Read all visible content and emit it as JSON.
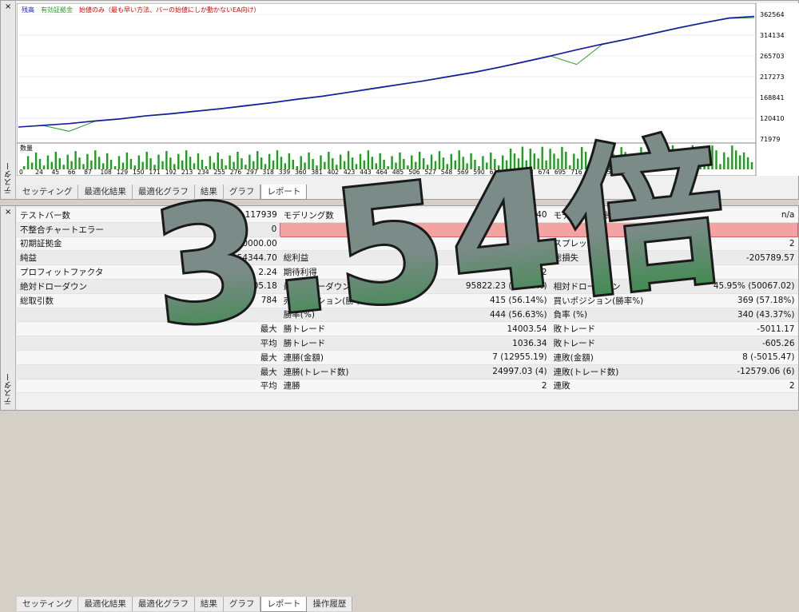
{
  "chart": {
    "legend": [
      "残高",
      "有効証拠金",
      "始値のみ（最も早い方法、バーの始値にしか動かないEA向け）"
    ],
    "legend_colors": [
      "#1a1aa0",
      "#2a9d2a",
      "#e00000"
    ],
    "y_ticks": [
      "362564",
      "314134",
      "265703",
      "217273",
      "168841",
      "120410",
      "71979"
    ],
    "x_ticks": [
      "0",
      "24",
      "45",
      "66",
      "87",
      "108",
      "129",
      "150",
      "171",
      "192",
      "213",
      "234",
      "255",
      "276",
      "297",
      "318",
      "339",
      "360",
      "381",
      "402",
      "423",
      "443",
      "464",
      "485",
      "506",
      "527",
      "548",
      "569",
      "590",
      "611",
      "632",
      "653",
      "674",
      "695",
      "716",
      "737",
      "758",
      "779"
    ],
    "volume_label": "数量"
  },
  "chart_data": {
    "type": "line",
    "title": "",
    "ylim": [
      71979,
      362564
    ],
    "series": [
      {
        "name": "残高",
        "color": "#1a1aa0",
        "values": [
          100000,
          104000,
          108000,
          114000,
          119000,
          126000,
          131000,
          137000,
          143000,
          150000,
          157000,
          165000,
          172000,
          181000,
          190000,
          199000,
          208000,
          218000,
          228000,
          240000,
          253000,
          266000,
          280000,
          293000,
          305000,
          318000,
          331000,
          343000,
          354000,
          358000
        ]
      },
      {
        "name": "有効証拠金",
        "color": "#2a9d2a",
        "values": [
          100000,
          103000,
          90000,
          113000,
          118000,
          125000,
          130000,
          136000,
          142000,
          149000,
          156000,
          164000,
          171000,
          180000,
          189000,
          198000,
          207000,
          217000,
          227000,
          239000,
          252000,
          265000,
          246000,
          292000,
          304000,
          317000,
          330000,
          342000,
          353000,
          355000
        ]
      }
    ]
  },
  "top_tabs": [
    "セッティング",
    "最適化結果",
    "最適化グラフ",
    "結果",
    "グラフ",
    "レポート"
  ],
  "top_tabs_active": 5,
  "bottom_tabs": [
    "セッティング",
    "最適化結果",
    "最適化グラフ",
    "結果",
    "グラフ",
    "レポート",
    "操作履歴"
  ],
  "bottom_tabs_active": 5,
  "side_label": "テスター",
  "close_glyph": "×",
  "report": {
    "r1": [
      "テストバー数",
      "117939",
      "モデリング数",
      "2340",
      "モデリング品質",
      "n/a"
    ],
    "r2": [
      "不整合チャートエラー",
      "0"
    ],
    "r3": [
      "初期証拠金",
      "100000.00",
      "",
      "",
      "スプレッド",
      "2"
    ],
    "r4": [
      "純益",
      "254344.70",
      "総利益",
      "460134.27",
      "総損失",
      "-205789.57"
    ],
    "r5": [
      "プロフィットファクタ",
      "2.24",
      "期待利得",
      "324.42"
    ],
    "r6": [
      "絶対ドローダウン",
      "1205.18",
      "最大ドローダウン",
      "95822.23 (34.20%)",
      "相対ドローダウン",
      "45.95% (50067.02)"
    ],
    "r7": [
      "総取引数",
      "784",
      "売りポジション(勝率%)",
      "415 (56.14%)",
      "買いポジション(勝率%)",
      "369 (57.18%)"
    ],
    "r8": [
      "",
      "",
      "勝率(%)",
      "444 (56.63%)",
      "負率 (%)",
      "340 (43.37%)"
    ],
    "r9": [
      "",
      "最大",
      "勝トレード",
      "14003.54",
      "敗トレード",
      "-5011.17"
    ],
    "r10": [
      "",
      "平均",
      "勝トレード",
      "1036.34",
      "敗トレード",
      "-605.26"
    ],
    "r11": [
      "",
      "最大",
      "連勝(金額)",
      "7 (12955.19)",
      "連敗(金額)",
      "8 (-5015.47)"
    ],
    "r12": [
      "",
      "最大",
      "連勝(トレード数)",
      "24997.03 (4)",
      "連敗(トレード数)",
      "-12579.06 (6)"
    ],
    "r13": [
      "",
      "平均",
      "連勝",
      "2",
      "連敗",
      "2"
    ]
  },
  "overlay_text": "3.54倍",
  "overlay_colors": {
    "fill_top": "#7b8b88",
    "fill_bottom": "#2e8b3e",
    "stroke": "#1a1a1a",
    "dot": "#1e8a2c"
  }
}
